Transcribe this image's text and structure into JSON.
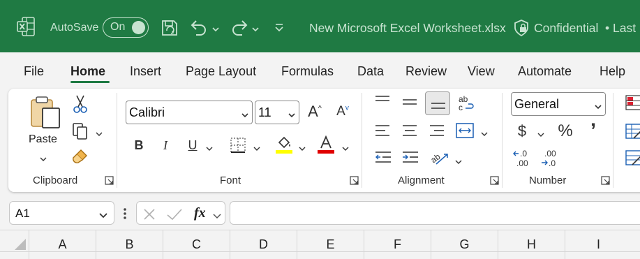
{
  "titlebar": {
    "autosave_label": "AutoSave",
    "autosave_state": "On",
    "document_title": "New Microsoft Excel Worksheet.xlsx",
    "sensitivity_label": "Confidential",
    "overflow_text": "• Last"
  },
  "tabs": [
    "File",
    "Home",
    "Insert",
    "Page Layout",
    "Formulas",
    "Data",
    "Review",
    "View",
    "Automate",
    "Help"
  ],
  "active_tab": "Home",
  "ribbon": {
    "clipboard": {
      "paste_label": "Paste",
      "group_label": "Clipboard"
    },
    "font": {
      "font_name": "Calibri",
      "font_size": "11",
      "group_label": "Font",
      "bold": "B",
      "italic": "I",
      "underline": "U",
      "grow": "A",
      "shrink": "A",
      "highlight_color": "#ffff00",
      "font_color": "#e00000"
    },
    "alignment": {
      "group_label": "Alignment"
    },
    "number": {
      "format": "General",
      "currency": "$",
      "percent": "%",
      "comma": "’",
      "inc_dec": ".0",
      "inc_dec2": ".00",
      "dec_dec": ".00",
      "dec_dec2": ".0",
      "group_label": "Number"
    }
  },
  "formula_bar": {
    "name_box": "A1",
    "fx": "fx",
    "formula": ""
  },
  "columns": [
    "A",
    "B",
    "C",
    "D",
    "E",
    "F",
    "G",
    "H",
    "I"
  ],
  "colors": {
    "accent": "#1f7a43"
  }
}
